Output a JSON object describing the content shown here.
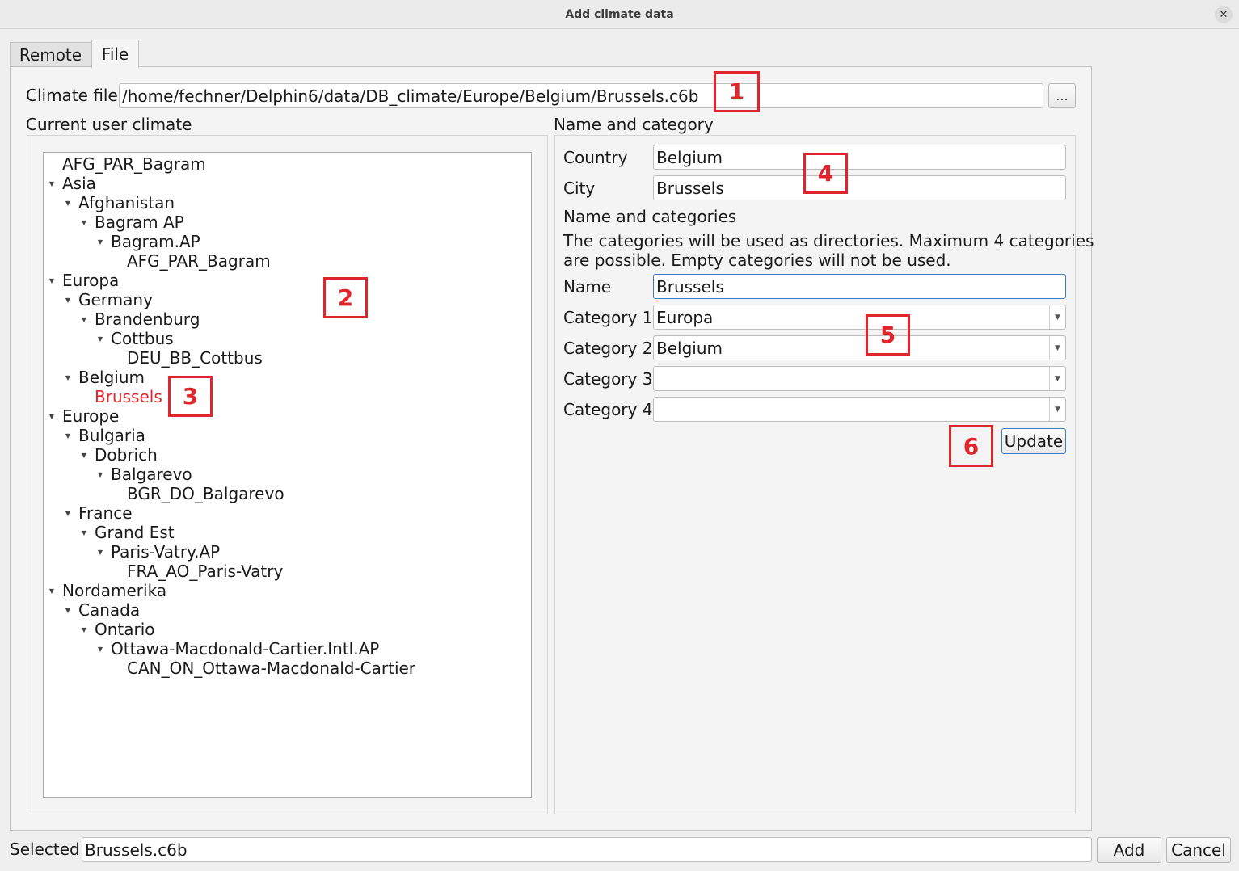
{
  "window": {
    "title": "Add climate data",
    "close_glyph": "✕"
  },
  "tabs": [
    {
      "label": "Remote"
    },
    {
      "label": "File"
    }
  ],
  "climate_file": {
    "label": "Climate file",
    "value": "/home/fechner/Delphin6/data/DB_climate/Europe/Belgium/Brussels.c6b",
    "browse_label": "..."
  },
  "user_climate": {
    "heading": "Current user climate",
    "tree": [
      {
        "label": "AFG_PAR_Bagram",
        "level": 0,
        "expandable": false
      },
      {
        "label": "Asia",
        "level": 0,
        "expandable": true
      },
      {
        "label": "Afghanistan",
        "level": 1,
        "expandable": true
      },
      {
        "label": "Bagram AP",
        "level": 2,
        "expandable": true
      },
      {
        "label": "Bagram.AP",
        "level": 3,
        "expandable": true
      },
      {
        "label": "AFG_PAR_Bagram",
        "level": 4,
        "expandable": false
      },
      {
        "label": "Europa",
        "level": 0,
        "expandable": true
      },
      {
        "label": "Germany",
        "level": 1,
        "expandable": true
      },
      {
        "label": "Brandenburg",
        "level": 2,
        "expandable": true
      },
      {
        "label": "Cottbus",
        "level": 3,
        "expandable": true
      },
      {
        "label": "DEU_BB_Cottbus",
        "level": 4,
        "expandable": false
      },
      {
        "label": "Belgium",
        "level": 1,
        "expandable": true
      },
      {
        "label": "Brussels",
        "level": 2,
        "expandable": false,
        "selected": true
      },
      {
        "label": "Europe",
        "level": 0,
        "expandable": true
      },
      {
        "label": "Bulgaria",
        "level": 1,
        "expandable": true
      },
      {
        "label": "Dobrich",
        "level": 2,
        "expandable": true
      },
      {
        "label": "Balgarevo",
        "level": 3,
        "expandable": true
      },
      {
        "label": "BGR_DO_Balgarevo",
        "level": 4,
        "expandable": false
      },
      {
        "label": "France",
        "level": 1,
        "expandable": true
      },
      {
        "label": "Grand Est",
        "level": 2,
        "expandable": true
      },
      {
        "label": "Paris-Vatry.AP",
        "level": 3,
        "expandable": true
      },
      {
        "label": "FRA_AO_Paris-Vatry",
        "level": 4,
        "expandable": false
      },
      {
        "label": "Nordamerika",
        "level": 0,
        "expandable": true
      },
      {
        "label": "Canada",
        "level": 1,
        "expandable": true
      },
      {
        "label": "Ontario",
        "level": 2,
        "expandable": true
      },
      {
        "label": "Ottawa-Macdonald-Cartier.Intl.AP",
        "level": 3,
        "expandable": true
      },
      {
        "label": "CAN_ON_Ottawa-Macdonald-Cartier",
        "level": 4,
        "expandable": false
      }
    ],
    "expand_glyph": "▼",
    "selected_color": "#e6242a"
  },
  "name_category": {
    "heading": "Name and category",
    "country_label": "Country",
    "country_value": "Belgium",
    "city_label": "City",
    "city_value": "Brussels",
    "subheading": "Name and categories",
    "description_line1": "The categories will be used as directories. Maximum 4 categories",
    "description_line2": "are possible. Empty categories will not be used.",
    "name_label": "Name",
    "name_value": "Brussels",
    "categories": [
      {
        "label": "Category 1",
        "value": "Europa"
      },
      {
        "label": "Category 2",
        "value": "Belgium"
      },
      {
        "label": "Category 3",
        "value": ""
      },
      {
        "label": "Category 4",
        "value": ""
      }
    ],
    "combo_arrow_glyph": "▼",
    "update_label": "Update"
  },
  "footer": {
    "selected_label": "Selected",
    "selected_value": "Brussels.c6b",
    "add_label": "Add",
    "cancel_label": "Cancel"
  },
  "callouts": [
    "1",
    "2",
    "3",
    "4",
    "5",
    "6"
  ],
  "colors": {
    "callout": "#e0252d",
    "focus": "#3b7bbf"
  }
}
